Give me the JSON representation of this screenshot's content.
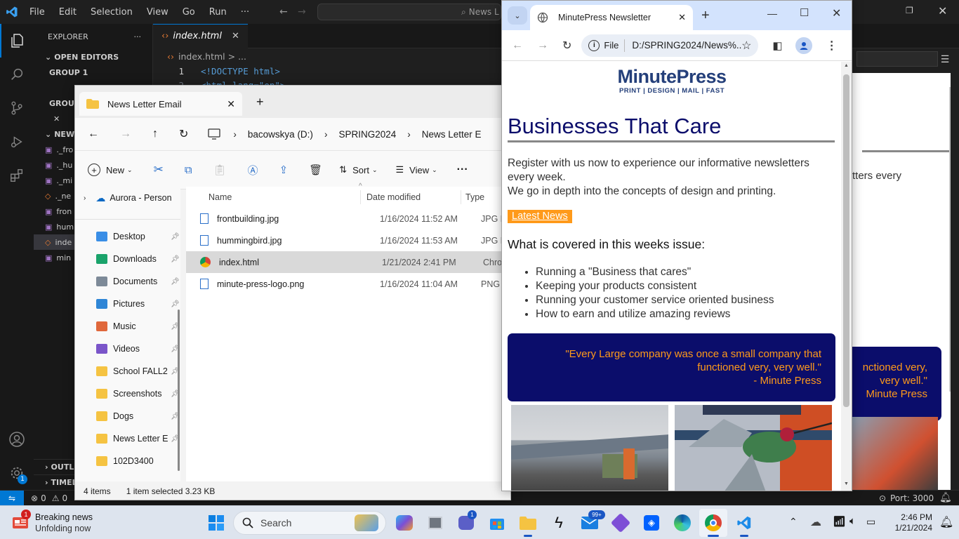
{
  "vscode": {
    "menu": [
      "File",
      "Edit",
      "Selection",
      "View",
      "Go",
      "Run",
      "···"
    ],
    "search_text": "News L",
    "sidebar": {
      "title": "EXPLORER",
      "open_editors": "OPEN EDITORS",
      "group1": "GROUP 1",
      "group2": "GROUP",
      "project": "NEWS",
      "files": [
        "._fro",
        "._hu",
        "._mi",
        "._ne",
        "fron",
        "hum",
        "inde",
        "min"
      ],
      "outline": "OUTLI",
      "timeline": "TIMELI"
    },
    "tab": "index.html",
    "breadcrumb": "index.html > ...",
    "code_lines": [
      {
        "num": "1",
        "text": "<!DOCTYPE html>"
      },
      {
        "num": "2",
        "text": "<html lang=\"en\">"
      }
    ],
    "status": {
      "errors": "0",
      "warnings": "0",
      "port": "Port: 3000"
    },
    "preview": {
      "text1": "tters every",
      "quote": "nctioned very, very well.\" Minute Press"
    }
  },
  "explorer": {
    "tab_title": "News Letter Email",
    "breadcrumb": [
      "bacowskya (D:)",
      "SPRING2024",
      "News Letter E"
    ],
    "cmd": {
      "new": "New",
      "sort": "Sort",
      "view": "View"
    },
    "nav": {
      "onedrive": "Aurora - Person",
      "items": [
        {
          "label": "Desktop",
          "icon": "desktop-icon",
          "color": "#3a8ee6"
        },
        {
          "label": "Downloads",
          "icon": "downloads-icon",
          "color": "#1aa36b"
        },
        {
          "label": "Documents",
          "icon": "documents-icon",
          "color": "#7d8a98"
        },
        {
          "label": "Pictures",
          "icon": "pictures-icon",
          "color": "#2f86d6"
        },
        {
          "label": "Music",
          "icon": "music-icon",
          "color": "#e0683c"
        },
        {
          "label": "Videos",
          "icon": "videos-icon",
          "color": "#7a55c9"
        },
        {
          "label": "School FALL2",
          "icon": "folder-icon",
          "color": "#f5c342"
        },
        {
          "label": "Screenshots",
          "icon": "folder-icon",
          "color": "#f5c342"
        },
        {
          "label": "Dogs",
          "icon": "folder-icon",
          "color": "#f5c342"
        },
        {
          "label": "News Letter E",
          "icon": "folder-icon",
          "color": "#f5c342"
        },
        {
          "label": "102D3400",
          "icon": "folder-icon",
          "color": "#f5c342"
        }
      ]
    },
    "columns": {
      "name": "Name",
      "date": "Date modified",
      "type": "Type"
    },
    "files": [
      {
        "name": "frontbuilding.jpg",
        "date": "1/16/2024 11:52 AM",
        "type": "JPG F"
      },
      {
        "name": "hummingbird.jpg",
        "date": "1/16/2024 11:53 AM",
        "type": "JPG F"
      },
      {
        "name": "index.html",
        "date": "1/21/2024 2:41 PM",
        "type": "Chro"
      },
      {
        "name": "minute-press-logo.png",
        "date": "1/16/2024 11:04 AM",
        "type": "PNG"
      }
    ],
    "status": {
      "count": "4 items",
      "selected": "1 item selected  3.23 KB"
    }
  },
  "chrome": {
    "tab_title": "MinutePress Newsletter",
    "omni_chip": "File",
    "url": "D:/SPRING2024/News%...",
    "page": {
      "logo_main": "MinutePress",
      "logo_tag": "PRINT | DESIGN | MAIL | FAST",
      "heading": "Businesses That Care",
      "intro1": "Register with us now to experience our informative newsletters every week.",
      "intro2": "We go in depth into the concepts of design and printing.",
      "latest_btn": "Latest News",
      "subheading": "What is covered in this weeks issue:",
      "bullets": [
        "Running a \"Business that cares\"",
        "Keeping your products consistent",
        "Running your customer service oriented business",
        "How to earn and utilize amazing reviews"
      ],
      "quote1": "\"Every Large company was once a small company that",
      "quote2": "functioned very, very well.\"",
      "quote3": "- Minute Press"
    }
  },
  "taskbar": {
    "news_title": "Breaking news",
    "news_sub": "Unfolding now",
    "news_badge": "1",
    "search": "Search",
    "time": "2:46 PM",
    "date": "1/21/2024",
    "mail_badge": "99+",
    "teams_badge": "1"
  },
  "colors": {
    "navy": "#0b0d6b",
    "orange": "#ff9a1a",
    "accent": "#005fb8",
    "vs_blue": "#0078d4"
  }
}
